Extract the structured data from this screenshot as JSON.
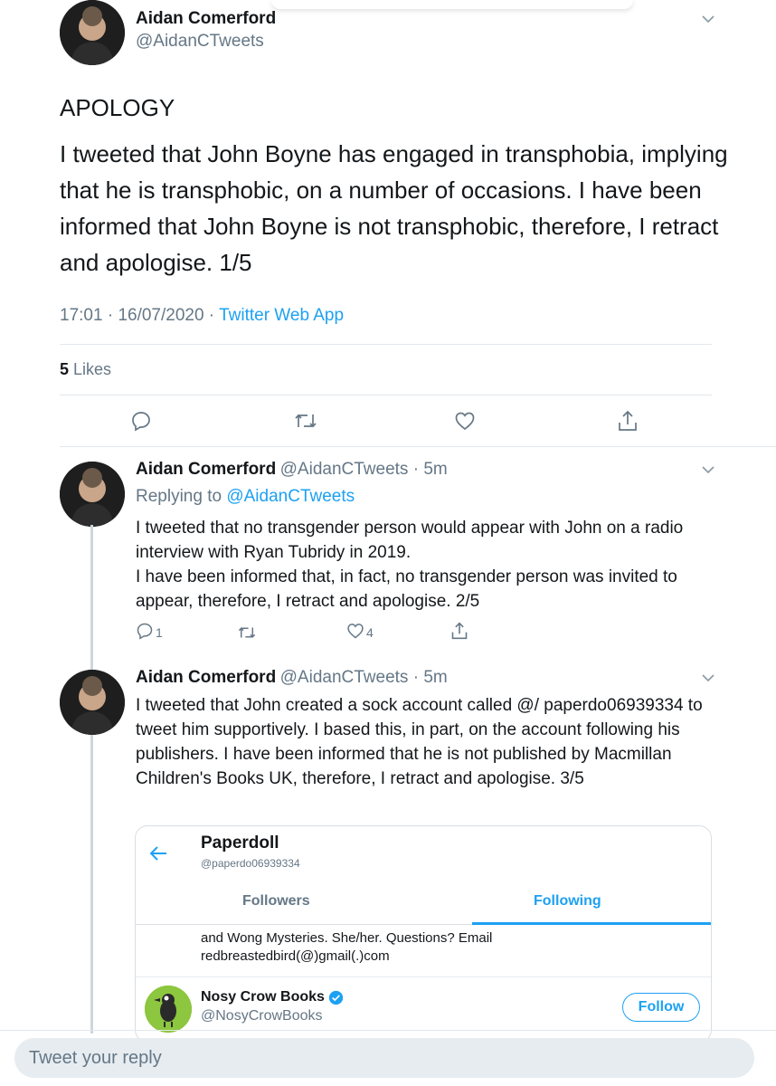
{
  "main_tweet": {
    "author_name": "Aidan Comerford",
    "author_handle": "@AidanCTweets",
    "title": "APOLOGY",
    "body": "I tweeted that John Boyne has engaged in transphobia, implying that he is transphobic, on a number of occasions. I have been informed that John Boyne is not transphobic, therefore, I retract and apologise. 1/5",
    "time": "17:01",
    "date": "16/07/2020",
    "app": "Twitter Web App",
    "likes_count": "5",
    "likes_label": "Likes"
  },
  "reply1": {
    "author_name": "Aidan Comerford",
    "author_handle": "@AidanCTweets",
    "time_ago": "5m",
    "replying_prefix": "Replying to",
    "replying_to": "@AidanCTweets",
    "body": "I tweeted that no transgender person would appear with John on a radio interview with Ryan Tubridy in 2019.\nI have been informed that, in fact, no transgender person was invited to appear, therefore, I retract and apologise. 2/5",
    "reply_count": "1",
    "like_count": "4"
  },
  "reply2": {
    "author_name": "Aidan Comerford",
    "author_handle": "@AidanCTweets",
    "time_ago": "5m",
    "body": "I tweeted that John created a sock account called @/ paperdo06939334 to tweet him supportively. I based this, in part, on the account following his publishers. I have been informed that he is not published by Macmillan Children's Books UK, therefore, I retract and apologise. 3/5"
  },
  "embed": {
    "profile_name": "Paperdoll",
    "profile_handle": "@paperdo06939334",
    "tab_followers": "Followers",
    "tab_following": "Following",
    "bio_line1": "and Wong Mysteries. She/her. Questions? Email",
    "bio_line2": "redbreastedbird(@)gmail(.)com",
    "account_name": "Nosy Crow Books",
    "account_handle": "@NosyCrowBooks",
    "follow_label": "Follow"
  },
  "reply_bar": {
    "placeholder": "Tweet your reply"
  },
  "icons": {
    "reply": "reply-icon",
    "retweet": "retweet-icon",
    "like": "like-icon",
    "share": "share-icon",
    "caret": "chevron-down-icon",
    "back": "back-arrow-icon",
    "verified": "verified-badge-icon"
  },
  "colors": {
    "accent": "#1da1f2",
    "secondary_text": "#657786",
    "primary_text": "#14171a"
  }
}
